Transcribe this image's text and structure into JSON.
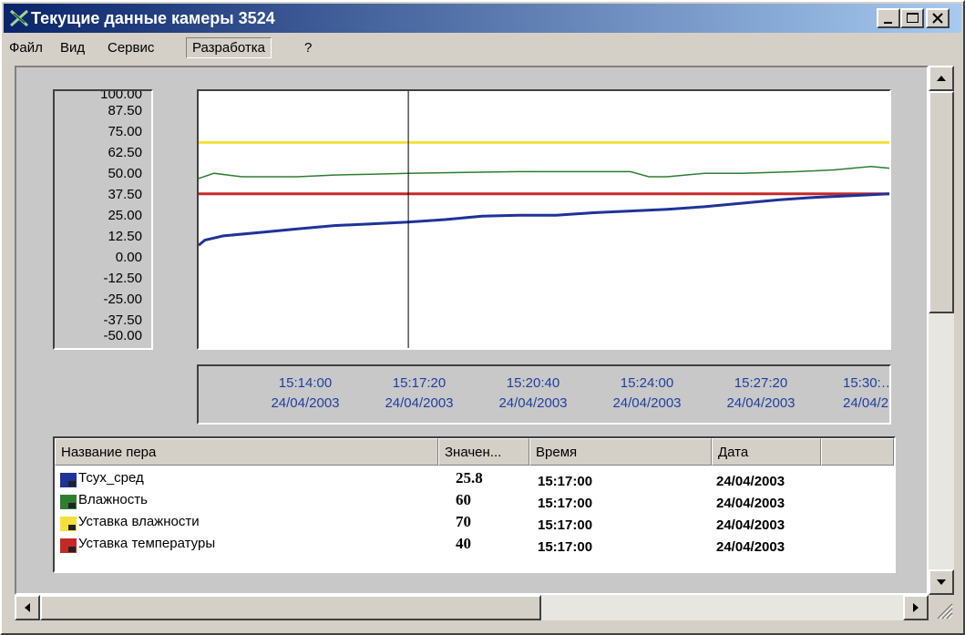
{
  "window": {
    "title": "Текущие данные камеры 3524",
    "buttons": [
      "minimize",
      "maximize",
      "close"
    ]
  },
  "menu": [
    {
      "label": "Файл",
      "active": false
    },
    {
      "label": "Вид",
      "active": false
    },
    {
      "label": "Сервис",
      "active": false
    },
    {
      "label": "Разработка",
      "active": true
    },
    {
      "label": "?",
      "active": false
    }
  ],
  "colors": {
    "tsux": "#1f3399",
    "humidity": "#2e7d32",
    "humidity_setpoint": "#f5e03a",
    "temp_setpoint": "#c62828",
    "cursor": "#000000"
  },
  "chart_data": {
    "type": "line",
    "ylim": [
      -50,
      100
    ],
    "y_ticks": [
      "100.00",
      "87.50",
      "75.00",
      "62.50",
      "50.00",
      "37.50",
      "25.00",
      "12.50",
      "0.00",
      "-12.50",
      "-25.00",
      "-37.50",
      "-50.00"
    ],
    "x_ticks": [
      {
        "time": "15:14:00",
        "date": "24/04/2003"
      },
      {
        "time": "15:17:20",
        "date": "24/04/2003"
      },
      {
        "time": "15:20:40",
        "date": "24/04/2003"
      },
      {
        "time": "15:24:00",
        "date": "24/04/2003"
      },
      {
        "time": "15:27:20",
        "date": "24/04/2003"
      },
      {
        "time": "15:30:…",
        "date": "24/04/2…"
      }
    ],
    "xlim": [
      "15:11:20",
      "15:30:00"
    ],
    "cursor_x": "15:17:00",
    "series": [
      {
        "name": "Тсух_сред",
        "color_key": "tsux",
        "x": [
          "15:11:20",
          "15:11:30",
          "15:12:00",
          "15:13:00",
          "15:14:00",
          "15:15:00",
          "15:16:00",
          "15:17:00",
          "15:18:00",
          "15:19:00",
          "15:20:00",
          "15:21:00",
          "15:22:00",
          "15:23:00",
          "15:24:00",
          "15:25:00",
          "15:26:00",
          "15:27:00",
          "15:28:00",
          "15:29:00",
          "15:30:00"
        ],
        "y": [
          10,
          13,
          15.5,
          17.5,
          19.5,
          21.5,
          22.5,
          23.5,
          25,
          27,
          27.5,
          27.5,
          29,
          30,
          31,
          32.5,
          34.5,
          36.5,
          38,
          39,
          40
        ]
      },
      {
        "name": "Влажность",
        "color_key": "humidity",
        "x": [
          "15:11:20",
          "15:11:45",
          "15:12:30",
          "15:14:00",
          "15:15:00",
          "15:16:00",
          "15:17:00",
          "15:18:30",
          "15:20:00",
          "15:22:00",
          "15:23:00",
          "15:23:30",
          "15:24:00",
          "15:25:00",
          "15:26:00",
          "15:27:30",
          "15:28:30",
          "15:29:30",
          "15:30:00"
        ],
        "y": [
          49,
          52,
          50,
          50,
          51,
          51.5,
          52,
          52.5,
          53,
          53,
          53,
          50,
          50,
          52,
          52,
          53,
          54,
          56,
          55
        ]
      },
      {
        "name": "Уставка влажности",
        "color_key": "humidity_setpoint",
        "x": [
          "15:11:20",
          "15:30:00"
        ],
        "y": [
          70,
          70
        ]
      },
      {
        "name": "Уставка температуры",
        "color_key": "temp_setpoint",
        "x": [
          "15:11:20",
          "15:30:00"
        ],
        "y": [
          40,
          40
        ]
      }
    ]
  },
  "legend": {
    "headers": {
      "name": "Название пера",
      "value": "Значен...",
      "time": "Время",
      "date": "Дата"
    },
    "rows": [
      {
        "name": "Тсух_сред",
        "value": "25.8",
        "time": "15:17:00",
        "date": "24/04/2003",
        "color_key": "tsux"
      },
      {
        "name": "Влажность",
        "value": "60",
        "time": "15:17:00",
        "date": "24/04/2003",
        "color_key": "humidity"
      },
      {
        "name": "Уставка влажности",
        "value": "70",
        "time": "15:17:00",
        "date": "24/04/2003",
        "color_key": "humidity_setpoint"
      },
      {
        "name": "Уставка температуры",
        "value": "40",
        "time": "15:17:00",
        "date": "24/04/2003",
        "color_key": "temp_setpoint"
      }
    ]
  }
}
